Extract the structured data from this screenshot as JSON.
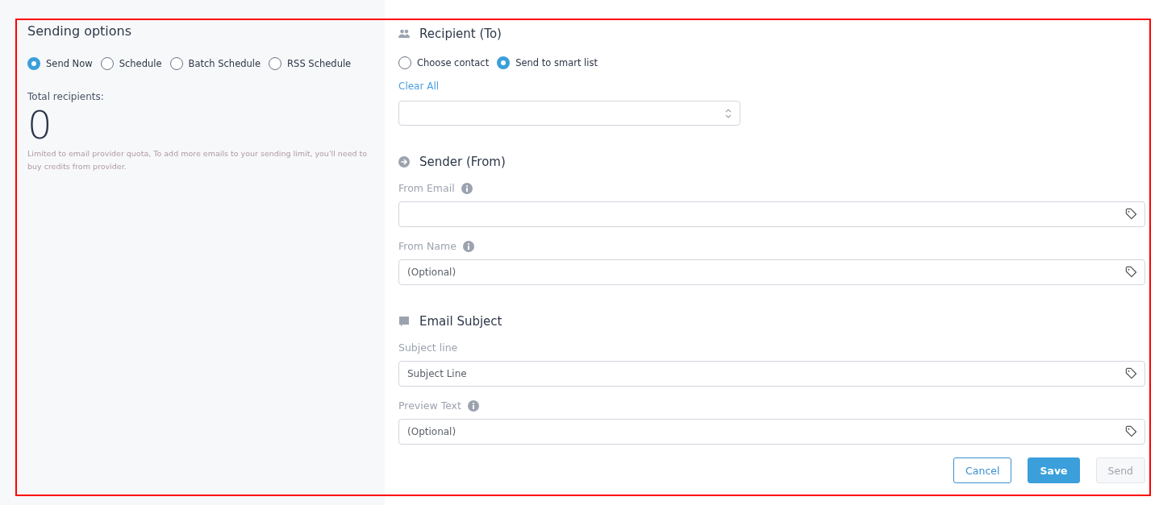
{
  "sending_options": {
    "title": "Sending options",
    "options": [
      {
        "label": "Send Now",
        "selected": true
      },
      {
        "label": "Schedule",
        "selected": false
      },
      {
        "label": "Batch Schedule",
        "selected": false
      },
      {
        "label": "RSS Schedule",
        "selected": false
      }
    ],
    "total_label": "Total recipients:",
    "total_value": "0",
    "note": "Limited to email provider quota, To add more emails to your sending limit, you'll need to buy credits from provider."
  },
  "recipient": {
    "title": "Recipient (To)",
    "options": [
      {
        "label": "Choose contact",
        "selected": false
      },
      {
        "label": "Send to smart list",
        "selected": true
      }
    ],
    "clear_all": "Clear All"
  },
  "sender": {
    "title": "Sender (From)",
    "fields": [
      {
        "label": "From Email",
        "info": true
      },
      {
        "label": "From Name",
        "info": true,
        "placeholder": "(Optional)"
      }
    ]
  },
  "subject": {
    "title": "Email Subject",
    "fields": [
      {
        "label": "Subject line",
        "info": false,
        "placeholder": "Subject Line"
      },
      {
        "label": "Preview Text",
        "info": true,
        "placeholder": "(Optional)"
      }
    ]
  },
  "buttons": [
    {
      "label": "Cancel",
      "kind": "outline"
    },
    {
      "label": "Save",
      "kind": "primary"
    },
    {
      "label": "Send",
      "kind": "disabled"
    }
  ]
}
